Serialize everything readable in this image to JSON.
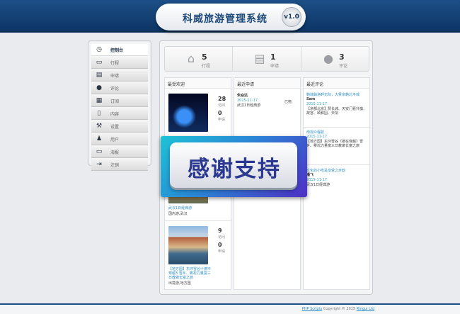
{
  "header": {
    "title": "科威旅游管理系统",
    "version": "v1.0"
  },
  "sidebar": {
    "items": [
      {
        "label": "控制台",
        "icon": "dashboard-gauge-icon",
        "glyph": "◷",
        "active": true
      },
      {
        "label": "行程",
        "icon": "folder-icon",
        "glyph": "▭"
      },
      {
        "label": "申请",
        "icon": "clipboard-icon",
        "glyph": "▤"
      },
      {
        "label": "评论",
        "icon": "speech-bubble-icon",
        "glyph": "●"
      },
      {
        "label": "订阅",
        "icon": "newspaper-icon",
        "glyph": "▦"
      },
      {
        "label": "内容",
        "icon": "document-icon",
        "glyph": "▯"
      },
      {
        "label": "设置",
        "icon": "wrench-icon",
        "glyph": "⚒"
      },
      {
        "label": "用户",
        "icon": "users-icon",
        "glyph": "♟"
      },
      {
        "label": "海报",
        "icon": "monitor-icon",
        "glyph": "▭"
      },
      {
        "label": "注销",
        "icon": "logout-icon",
        "glyph": "⇥"
      }
    ]
  },
  "stats": [
    {
      "count": "5",
      "label": "行程",
      "icon": "home-icon",
      "glyph": "⌂"
    },
    {
      "count": "1",
      "label": "申请",
      "icon": "clipboard-icon",
      "glyph": "▤"
    },
    {
      "count": "3",
      "label": "评论",
      "icon": "speech-bubble-icon",
      "glyph": "●"
    }
  ],
  "col1": {
    "heading": "最受欢迎",
    "cards": [
      {
        "img": "night-light-show-photo",
        "views": "28",
        "views_label": "访问",
        "apps": "0",
        "apps_label": "申请"
      },
      {
        "img": "scenic-photo",
        "title": "武汉1日经典游",
        "sub": "国内游,武汉"
      },
      {
        "img": "waterfront-town-photo",
        "views": "9",
        "views_label": "访问",
        "apps": "0",
        "apps_label": "申请",
        "title": "【地方国】东环雪谷十德不穿越3 雪乡、雾凇力量富三日教做长富之旅",
        "sub": "出境游,地方国"
      }
    ]
  },
  "col2": {
    "heading": "最近申请",
    "entries": [
      {
        "name": "朱焱达",
        "date": "2015-11-17",
        "text": "武汉1日经典游",
        "status": "已拖"
      }
    ]
  },
  "col3": {
    "heading": "最近评论",
    "entries": [
      {
        "title": "韩城曲洛畔无际，大赞京韩北平城",
        "name": "Sam",
        "date": "2015-11-17",
        "text": "【京都北京】赞长城、天安门看升旗、故宫、颐和园、天坛"
      },
      {
        "title": "南观众程航",
        "name": "",
        "date": "2015-11-17",
        "text": "【地方国】东环雪谷《德在穿越》雪乡、雾凇力量富三日教做长富之旅"
      },
      {
        "title": "文化的小吃是享受之步韵",
        "name": "潘飞",
        "date": "2015-11-17",
        "text": "武汉1日经典游"
      }
    ]
  },
  "overlay": {
    "text": "感谢支持"
  },
  "footer": {
    "brand": "PHP Scripts",
    "copyright": "Copyright © 2015",
    "company": "Ringui Ltd"
  },
  "colors": {
    "header": "#1d4f86",
    "accent": "#2e8fc4",
    "date": "#33a7c2"
  }
}
